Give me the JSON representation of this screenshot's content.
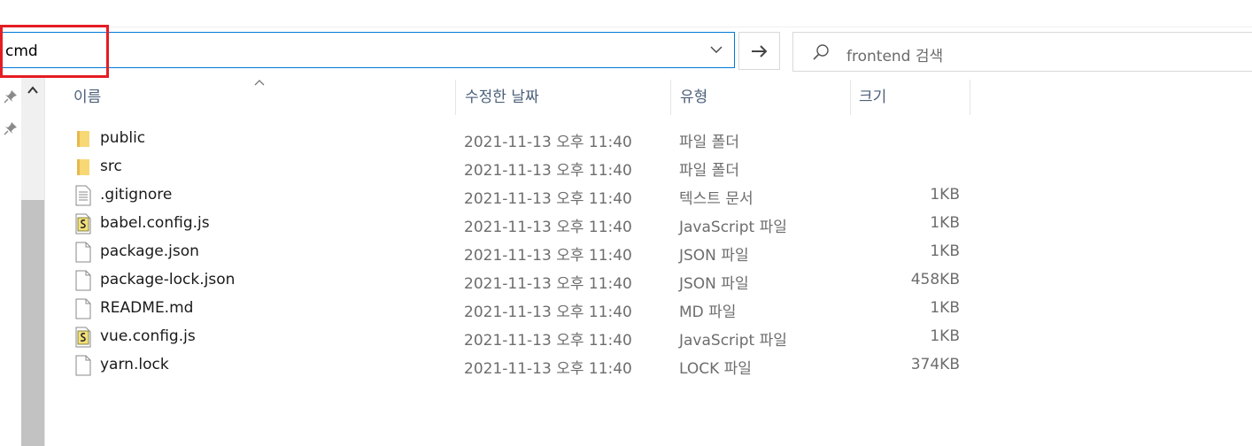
{
  "address_bar": {
    "value": "cmd"
  },
  "search": {
    "placeholder": "frontend 검색"
  },
  "columns": {
    "name": "이름",
    "date": "수정한 날짜",
    "type": "유형",
    "size": "크기"
  },
  "files": [
    {
      "name": "public",
      "date": "2021-11-13 오후 11:40",
      "type": "파일 폴더",
      "size": "",
      "icon": "folder-icon"
    },
    {
      "name": "src",
      "date": "2021-11-13 오후 11:40",
      "type": "파일 폴더",
      "size": "",
      "icon": "folder-icon"
    },
    {
      "name": ".gitignore",
      "date": "2021-11-13 오후 11:40",
      "type": "텍스트 문서",
      "size": "1KB",
      "icon": "text-file-icon"
    },
    {
      "name": "babel.config.js",
      "date": "2021-11-13 오후 11:40",
      "type": "JavaScript 파일",
      "size": "1KB",
      "icon": "script-file-icon"
    },
    {
      "name": "package.json",
      "date": "2021-11-13 오후 11:40",
      "type": "JSON 파일",
      "size": "1KB",
      "icon": "blank-file-icon"
    },
    {
      "name": "package-lock.json",
      "date": "2021-11-13 오후 11:40",
      "type": "JSON 파일",
      "size": "458KB",
      "icon": "blank-file-icon"
    },
    {
      "name": "README.md",
      "date": "2021-11-13 오후 11:40",
      "type": "MD 파일",
      "size": "1KB",
      "icon": "blank-file-icon"
    },
    {
      "name": "vue.config.js",
      "date": "2021-11-13 오후 11:40",
      "type": "JavaScript 파일",
      "size": "1KB",
      "icon": "script-file-icon"
    },
    {
      "name": "yarn.lock",
      "date": "2021-11-13 오후 11:40",
      "type": "LOCK 파일",
      "size": "374KB",
      "icon": "blank-file-icon"
    }
  ],
  "colors": {
    "address_border": "#0078d7",
    "highlight": "#e51c23",
    "folder": "#f8d775"
  }
}
